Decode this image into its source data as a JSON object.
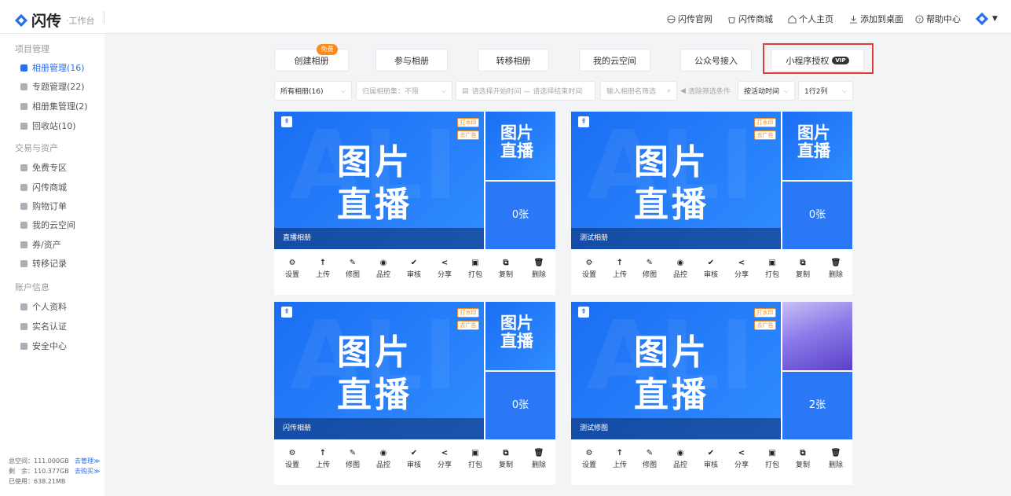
{
  "brand": {
    "name": "闪传",
    "sub": "·工作台"
  },
  "topnav": [
    {
      "label": "闪传官网",
      "icon": "globe-icon"
    },
    {
      "label": "闪传商城",
      "icon": "shop-icon"
    },
    {
      "label": "个人主页",
      "icon": "home-icon"
    },
    {
      "label": "添加到桌面",
      "icon": "download-icon"
    },
    {
      "label": "帮助中心",
      "icon": "help-icon"
    }
  ],
  "sidebar": {
    "groups": [
      "项目管理",
      "交易与资产",
      "账户信息"
    ],
    "items": [
      {
        "label": "相册管理(16)"
      },
      {
        "label": "专题管理(22)"
      },
      {
        "label": "相册集管理(2)"
      },
      {
        "label": "回收站(10)"
      },
      {
        "label": "免费专区"
      },
      {
        "label": "闪传商城"
      },
      {
        "label": "购物订单"
      },
      {
        "label": "我的云空间"
      },
      {
        "label": "券/资产"
      },
      {
        "label": "转移记录"
      },
      {
        "label": "个人资料"
      },
      {
        "label": "实名认证"
      },
      {
        "label": "安全中心"
      }
    ],
    "storage": {
      "total": "总空间：111.000GB",
      "total_link": "去管理≫",
      "remain": "剩　余：110.377GB",
      "remain_link": "去购买≫",
      "used": "已使用：638.21MB"
    }
  },
  "actions": {
    "create": "创建相册",
    "free_badge": "免费",
    "join": "参与相册",
    "transfer": "转移相册",
    "cloud": "我的云空间",
    "official": "公众号接入",
    "mini": "小程序授权",
    "vip": "VIP"
  },
  "filters": {
    "all": "所有相册(16)",
    "collection": "归属相册集：不限",
    "date_placeholder": "请选择开始时间 — 请选择结束时间",
    "search_placeholder": "输入相册名筛选",
    "clear": "清除筛选条件",
    "sort": "按活动时间",
    "layout": "1行2列"
  },
  "card_text": {
    "big1": "图片",
    "big2": "直播",
    "side1": "图片",
    "side2": "直播",
    "watermark": "打水印",
    "ads": "去广告"
  },
  "albums": [
    {
      "name": "直播相册",
      "count": "0张"
    },
    {
      "name": "测试相册",
      "count": "0张"
    },
    {
      "name": "闪传相册",
      "count": "0张"
    },
    {
      "name": "测试修图",
      "count": "2张"
    }
  ],
  "card_actions": [
    "设置",
    "上传",
    "修图",
    "品控",
    "审核",
    "分享",
    "打包",
    "复制",
    "删除"
  ]
}
